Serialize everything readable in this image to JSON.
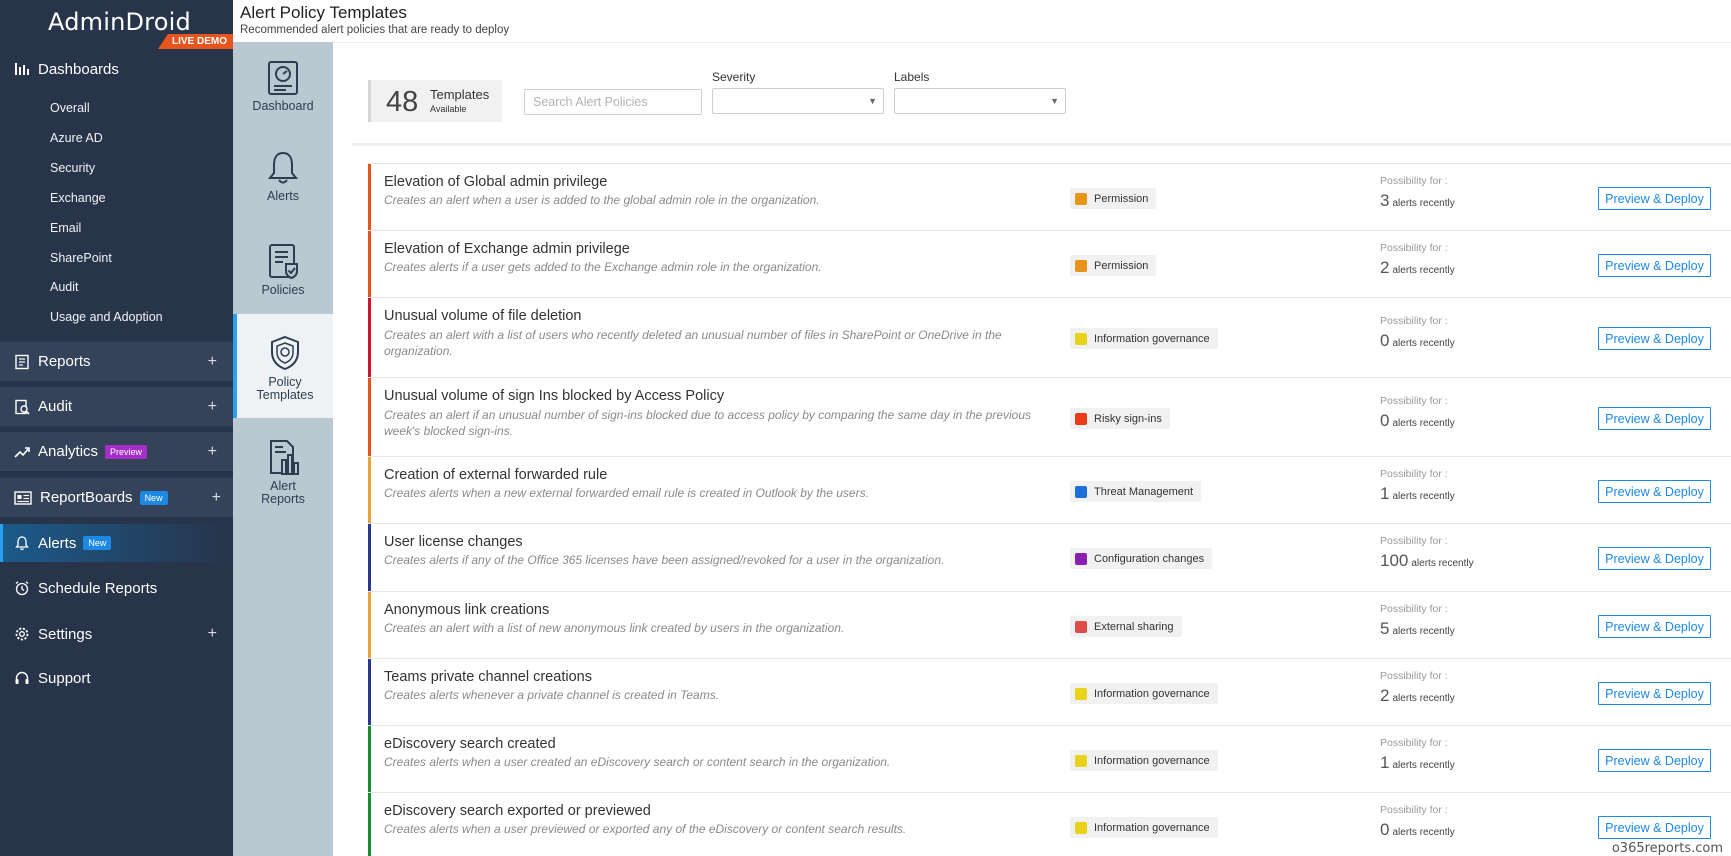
{
  "app": {
    "logo": "AdminDroid",
    "live_demo": "LIVE DEMO"
  },
  "nav": {
    "dashboards": {
      "label": "Dashboards",
      "items": [
        "Overall",
        "Azure AD",
        "Security",
        "Exchange",
        "Email",
        "SharePoint",
        "Audit",
        "Usage and Adoption"
      ]
    },
    "reports": "Reports",
    "audit": "Audit",
    "analytics": "Analytics",
    "analytics_badge": "Preview",
    "reportboards": "ReportBoards",
    "reportboards_badge": "New",
    "alerts": "Alerts",
    "alerts_badge": "New",
    "schedule": "Schedule Reports",
    "settings": "Settings",
    "support": "Support",
    "plus": "+"
  },
  "rail": {
    "dashboard": "Dashboard",
    "alerts": "Alerts",
    "policies": "Policies",
    "policy_templates_1": "Policy",
    "policy_templates_2": "Templates",
    "alert_reports_1": "Alert",
    "alert_reports_2": "Reports"
  },
  "header": {
    "title": "Alert Policy Templates",
    "subtitle": "Recommended alert policies that are ready to deploy"
  },
  "filters": {
    "count": "48",
    "count_label": "Templates",
    "count_sub": "Available",
    "search_placeholder": "Search Alert Policies",
    "severity_label": "Severity",
    "labels_label": "Labels",
    "arrow": "▼"
  },
  "list": {
    "possibility_label": "Possibility for :",
    "alerts_unit": "alerts recently",
    "deploy_label": "Preview & Deploy",
    "rows": [
      {
        "title": "Elevation of Global admin privilege",
        "desc": "Creates an alert when a user is added to the global admin role in the organization.",
        "tag": "Permission",
        "tag_color": "#e8931a",
        "bar_color": "#e8541e",
        "count": "3"
      },
      {
        "title": "Elevation of Exchange admin privilege",
        "desc": "Creates alerts if a user gets added to the Exchange admin role in the organization.",
        "tag": "Permission",
        "tag_color": "#e8931a",
        "bar_color": "#e8541e",
        "count": "2"
      },
      {
        "title": "Unusual volume of file deletion",
        "desc": "Creates an alert with a list of users who recently deleted an unusual number of files in SharePoint or OneDrive in the organization.",
        "tag": "Information governance",
        "tag_color": "#e8d21a",
        "bar_color": "#d0112b",
        "count": "0"
      },
      {
        "title": "Unusual volume of sign Ins blocked by Access Policy",
        "desc": "Creates an alert if an unusual number of sign-ins blocked due to access policy by comparing the same day in the previous week's blocked sign-ins.",
        "tag": "Risky sign-ins",
        "tag_color": "#ec3b16",
        "bar_color": "#e8541e",
        "count": "0"
      },
      {
        "title": "Creation of external forwarded rule",
        "desc": "Creates alerts when a new external forwarded email rule is created in Outlook by the users.",
        "tag": "Threat Management",
        "tag_color": "#1e6fd9",
        "bar_color": "#e8a33a",
        "count": "1"
      },
      {
        "title": "User license changes",
        "desc": "Creates alerts if any of the Office 365 licenses have been assigned/revoked for a user in the organization.",
        "tag": "Configuration changes",
        "tag_color": "#8a1fb0",
        "bar_color": "#28388f",
        "count": "100"
      },
      {
        "title": "Anonymous link creations",
        "desc": "Creates an alert with a list of new anonymous link created by users in the organization.",
        "tag": "External sharing",
        "tag_color": "#e04b4b",
        "bar_color": "#e8a33a",
        "count": "5"
      },
      {
        "title": "Teams private channel creations",
        "desc": "Creates alerts whenever a private channel is created in Teams.",
        "tag": "Information governance",
        "tag_color": "#e8d21a",
        "bar_color": "#28388f",
        "count": "2"
      },
      {
        "title": "eDiscovery search created",
        "desc": "Creates alerts when a user created an eDiscovery search or content search in the organization.",
        "tag": "Information governance",
        "tag_color": "#e8d21a",
        "bar_color": "#1a8a2e",
        "count": "1"
      },
      {
        "title": "eDiscovery search exported or previewed",
        "desc": "Creates alerts when a user previewed or exported any of the eDiscovery or content search results.",
        "tag": "Information governance",
        "tag_color": "#e8d21a",
        "bar_color": "#1a8a2e",
        "count": "0"
      }
    ]
  },
  "watermark": "o365reports.com"
}
